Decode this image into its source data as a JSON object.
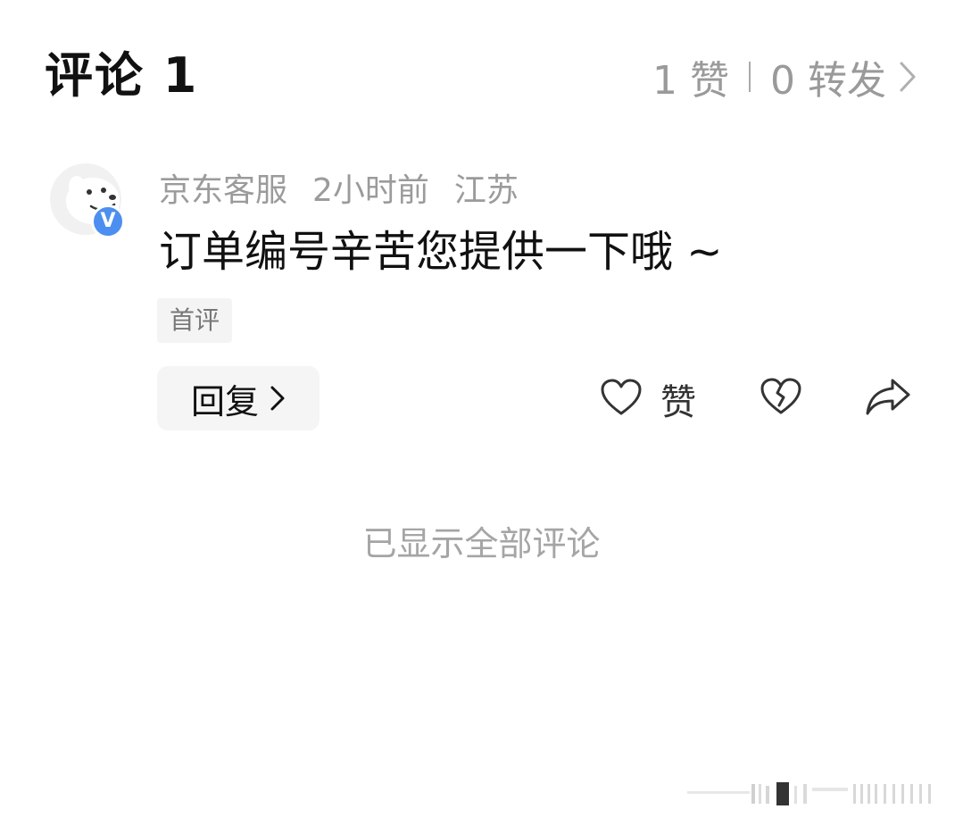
{
  "header": {
    "title": "评论 1",
    "likes": "1 赞",
    "reposts": "0 转发"
  },
  "comment": {
    "author": "京东客服",
    "time": "2小时前",
    "location": "江苏",
    "text": "订单编号辛苦您提供一下哦 ~",
    "tag": "首评",
    "verified_badge": "V"
  },
  "actions": {
    "reply_label": "回复",
    "like_label": "赞"
  },
  "footer": {
    "end_text": "已显示全部评论"
  },
  "icons": {
    "stats_chevron": "chevron-right-icon",
    "reply_chevron": "chevron-right-icon",
    "like": "heart-outline-icon",
    "dislike": "broken-heart-icon",
    "share": "share-arrow-icon"
  },
  "colors": {
    "verified_badge": "#4d8ff0",
    "muted_text": "#9b9b9b",
    "button_bg": "#f5f5f5"
  }
}
